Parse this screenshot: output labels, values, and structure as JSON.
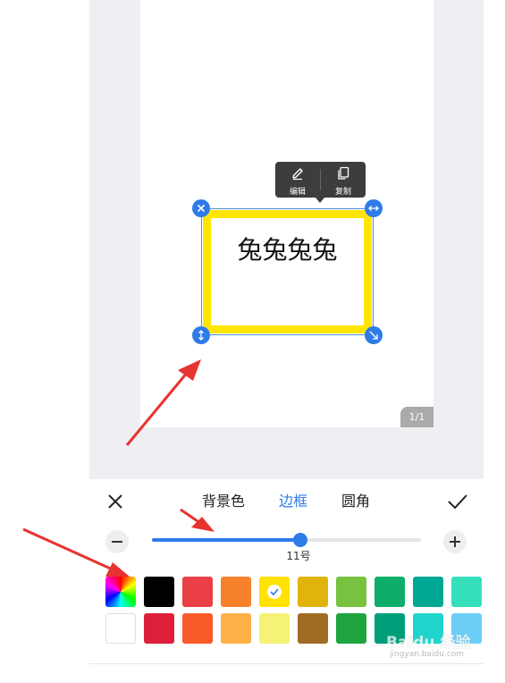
{
  "canvas": {
    "page_indicator": "1/1",
    "context_menu": {
      "items": [
        {
          "icon": "pencil-icon",
          "label": "编辑"
        },
        {
          "icon": "copy-icon",
          "label": "复制"
        }
      ]
    },
    "text_box": {
      "text": "兔兔兔兔",
      "border_color": "#ffe500",
      "selection_color": "#2f7be8"
    }
  },
  "panel": {
    "close_icon": "close-icon",
    "confirm_icon": "check-icon",
    "tabs": [
      {
        "label": "背景色",
        "active": false
      },
      {
        "label": "边框",
        "active": true
      },
      {
        "label": "圆角",
        "active": false
      }
    ],
    "slider": {
      "value_label": "11号",
      "fraction": 0.55
    },
    "swatches": [
      [
        "rainbow",
        "#000000",
        "#ea3f46",
        "#f7812b",
        "#ffe200",
        "#e0b40c",
        "#78c23f",
        "#0fad6a",
        "#00a896",
        "#36dfbc"
      ],
      [
        "#ffffff",
        "#dd1f3a",
        "#fb5a2a",
        "#fdb046",
        "#f5f277",
        "#a06c24",
        "#1ea540",
        "#009d79",
        "#1ed4cb",
        "#6ccdf6"
      ]
    ],
    "selected_swatch": "#ffe200"
  },
  "watermark": {
    "main": "Baidu 经验",
    "sub": "jingyan.baidu.com"
  },
  "colors": {
    "accent": "#2f7be8",
    "annotation_arrow": "#e8332f"
  }
}
